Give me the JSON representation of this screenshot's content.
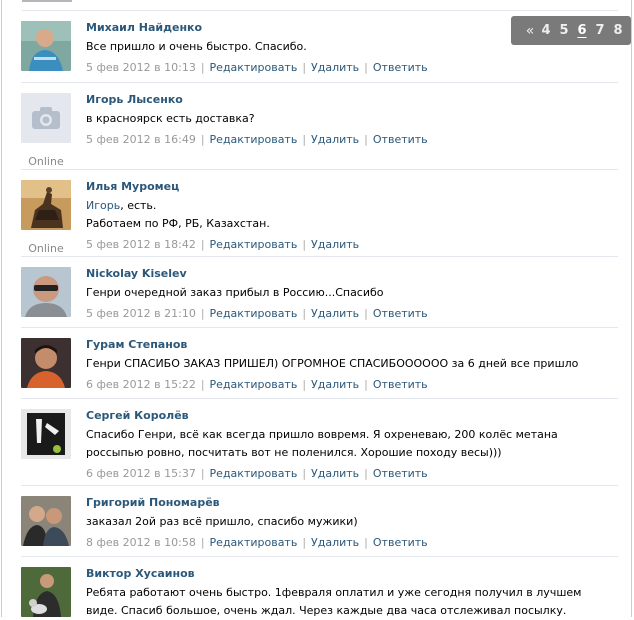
{
  "pager": {
    "prev": "«",
    "pages": [
      "4",
      "5",
      "6",
      "7",
      "8"
    ],
    "current": "6"
  },
  "actions": {
    "edit": "Редактировать",
    "delete": "Удалить",
    "reply": "Ответить",
    "separator": "|"
  },
  "comments": [
    {
      "author": "Михаил Найденко",
      "text": "Все пришло и очень быстро. Спасибо.",
      "date": "5 фев 2012 в 10:13"
    },
    {
      "author": "Игорь Лысенко",
      "text": "в красноярск есть доставка?",
      "date": "5 фев 2012 в 16:49",
      "status": "Online"
    },
    {
      "author": "Илья Муромец",
      "mention": "Игорь",
      "text_after_mention": ", есть.",
      "text2": "Работаем по РФ, РБ, Казахстан.",
      "date": "5 фев 2012 в 18:42",
      "status": "Online"
    },
    {
      "author": "Nickolay Kiselev",
      "text": "Генри очередной заказ прибыл в Россию...Спасибо",
      "date": "5 фев 2012 в 21:10"
    },
    {
      "author": "Гурам Степанов",
      "text": "Генри СПАСИБО ЗАКАЗ ПРИШЕЛ) ОГРОМНОЕ СПАСИБОООООО за 6 дней все пришло",
      "date": "6 фев 2012 в 15:22"
    },
    {
      "author": "Сергей Королёв",
      "text": "Спасибо Генри, всё как всегда пришло вовремя. Я охреневаю, 200 колёс метана россыпью ровно, посчитать вот не поленился. Хорошие походу весы)))",
      "date": "6 фев 2012 в 15:37"
    },
    {
      "author": "Григорий Пономарёв",
      "text": "заказал 2ой раз всё пришло, спасибо мужики)",
      "date": "8 фев 2012 в 10:58"
    },
    {
      "author": "Виктор Хусаинов",
      "text": "Ребята работают очень быстро. 1февраля оплатил и уже сегодня получил в лучшем виде. Спасиб большое, очень ждал. Через каждые два часа отслеживал посылку."
    }
  ]
}
